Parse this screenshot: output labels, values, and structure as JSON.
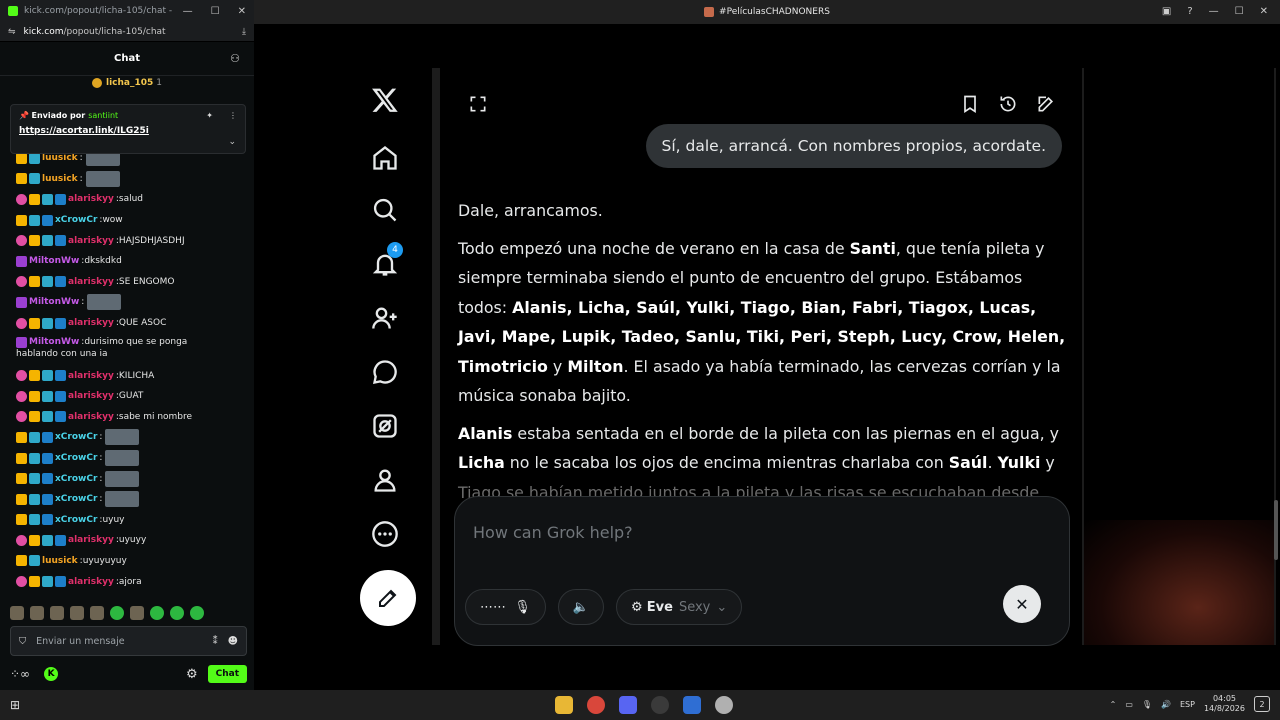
{
  "kick": {
    "window_title": "kick.com/popout/licha-105/chat - Go...",
    "url_host": "kick.com",
    "url_path": "/popout/licha-105/chat",
    "chat_title": "Chat",
    "viewer_name": "licha_105",
    "viewer_count": "1",
    "pinned": {
      "label": "Enviado por",
      "sender": "santiint",
      "link": "https://acortar.link/ILG25i"
    },
    "messages": [
      {
        "user": "luusick",
        "color": "#f5a524",
        "text": "",
        "badges": [
          "crown",
          "og"
        ],
        "emote": true
      },
      {
        "user": "luusick",
        "color": "#f5a524",
        "text": "",
        "badges": [
          "crown",
          "og"
        ],
        "emote": true
      },
      {
        "user": "alariskyy",
        "color": "#e0306b",
        "text": "salud",
        "badges": [
          "sub",
          "crown",
          "og",
          "kick"
        ],
        "emote": false
      },
      {
        "user": "xCrowCr",
        "color": "#4ad3e8",
        "text": "wow",
        "badges": [
          "crown",
          "og",
          "kick"
        ],
        "emote": false
      },
      {
        "user": "alariskyy",
        "color": "#e0306b",
        "text": "HAJSDHJASDHJ",
        "badges": [
          "sub",
          "crown",
          "og",
          "kick"
        ],
        "emote": false
      },
      {
        "user": "MiltonWw",
        "color": "#c55ae8",
        "text": "dkskdkd",
        "badges": [
          "vip"
        ],
        "emote": false
      },
      {
        "user": "alariskyy",
        "color": "#e0306b",
        "text": "SE ENGOMO",
        "badges": [
          "sub",
          "crown",
          "og",
          "kick"
        ],
        "emote": false
      },
      {
        "user": "MiltonWw",
        "color": "#c55ae8",
        "text": "",
        "badges": [
          "vip"
        ],
        "emote": true
      },
      {
        "user": "alariskyy",
        "color": "#e0306b",
        "text": "QUE ASOC",
        "badges": [
          "sub",
          "crown",
          "og",
          "kick"
        ],
        "emote": false
      },
      {
        "user": "MiltonWw",
        "color": "#c55ae8",
        "text": "durisimo que se ponga",
        "text2": "hablando con una ia",
        "badges": [
          "vip"
        ],
        "emote": false,
        "tall": true
      },
      {
        "user": "alariskyy",
        "color": "#e0306b",
        "text": "KILICHA",
        "badges": [
          "sub",
          "crown",
          "og",
          "kick"
        ],
        "emote": false
      },
      {
        "user": "alariskyy",
        "color": "#e0306b",
        "text": "GUAT",
        "badges": [
          "sub",
          "crown",
          "og",
          "kick"
        ],
        "emote": false
      },
      {
        "user": "alariskyy",
        "color": "#e0306b",
        "text": "sabe mi nombre",
        "badges": [
          "sub",
          "crown",
          "og",
          "kick"
        ],
        "emote": false
      },
      {
        "user": "xCrowCr",
        "color": "#4ad3e8",
        "text": "",
        "badges": [
          "crown",
          "og",
          "kick"
        ],
        "emote": true
      },
      {
        "user": "xCrowCr",
        "color": "#4ad3e8",
        "text": "",
        "badges": [
          "crown",
          "og",
          "kick"
        ],
        "emote": true
      },
      {
        "user": "xCrowCr",
        "color": "#4ad3e8",
        "text": "",
        "badges": [
          "crown",
          "og",
          "kick"
        ],
        "emote": true
      },
      {
        "user": "xCrowCr",
        "color": "#4ad3e8",
        "text": "",
        "badges": [
          "crown",
          "og",
          "kick"
        ],
        "emote": true
      },
      {
        "user": "xCrowCr",
        "color": "#4ad3e8",
        "text": "uyuy",
        "badges": [
          "crown",
          "og",
          "kick"
        ],
        "emote": false
      },
      {
        "user": "alariskyy",
        "color": "#e0306b",
        "text": "uyuyy",
        "badges": [
          "sub",
          "crown",
          "og",
          "kick"
        ],
        "emote": false
      },
      {
        "user": "luusick",
        "color": "#f5a524",
        "text": "uyuyuyuy",
        "badges": [
          "crown",
          "og"
        ],
        "emote": false
      },
      {
        "user": "alariskyy",
        "color": "#e0306b",
        "text": "ajora",
        "badges": [
          "sub",
          "crown",
          "og",
          "kick"
        ],
        "emote": false
      }
    ],
    "input_placeholder": "Enviar un mensaje",
    "chat_button": "Chat"
  },
  "main": {
    "window_title": "#PelículasCHADNONERS",
    "notification_count": "4",
    "user_message": "Sí, dale, arrancá. Con nombres propios, acordate.",
    "reply": {
      "p1": "Dale, arrancamos.",
      "p2_a": "Todo empezó una noche de verano en la casa de ",
      "p2_santi": "Santi",
      "p2_b": ", que tenía pileta y siempre terminaba siendo el punto de encuentro del grupo. Estábamos todos: ",
      "p2_names": "Alanis, Licha, Saúl, Yulki, Tiago, Bian, Fabri, Tiagox, Lucas, Javi, Mape, Lupik, Tadeo, Sanlu, Tiki, Peri, Steph, Lucy, Crow, Helen, Timotricio",
      "p2_y": " y ",
      "p2_milton": "Milton",
      "p2_c": ". El asado ya había terminado, las cervezas corrían y la música sonaba bajito.",
      "p3_alanis": "Alanis",
      "p3_a": " estaba sentada en el borde de la pileta con las piernas en el agua, y ",
      "p3_licha": "Licha",
      "p3_b": " no le sacaba los ojos de encima mientras charlaba con ",
      "p3_saul": "Saúl",
      "p3_c": ". ",
      "p3_yulki": "Yulki",
      "p3_d": " y",
      "p3_e": "Tiago se habían metido juntos a la pileta y las risas se escuchaban desde"
    },
    "composer": {
      "placeholder": "How can Grok help?",
      "voice_name": "Eve",
      "voice_style": "Sexy"
    }
  },
  "taskbar": {
    "lang": "ESP",
    "time": "04:05",
    "date": "14/8/2026",
    "notifications": "2"
  }
}
